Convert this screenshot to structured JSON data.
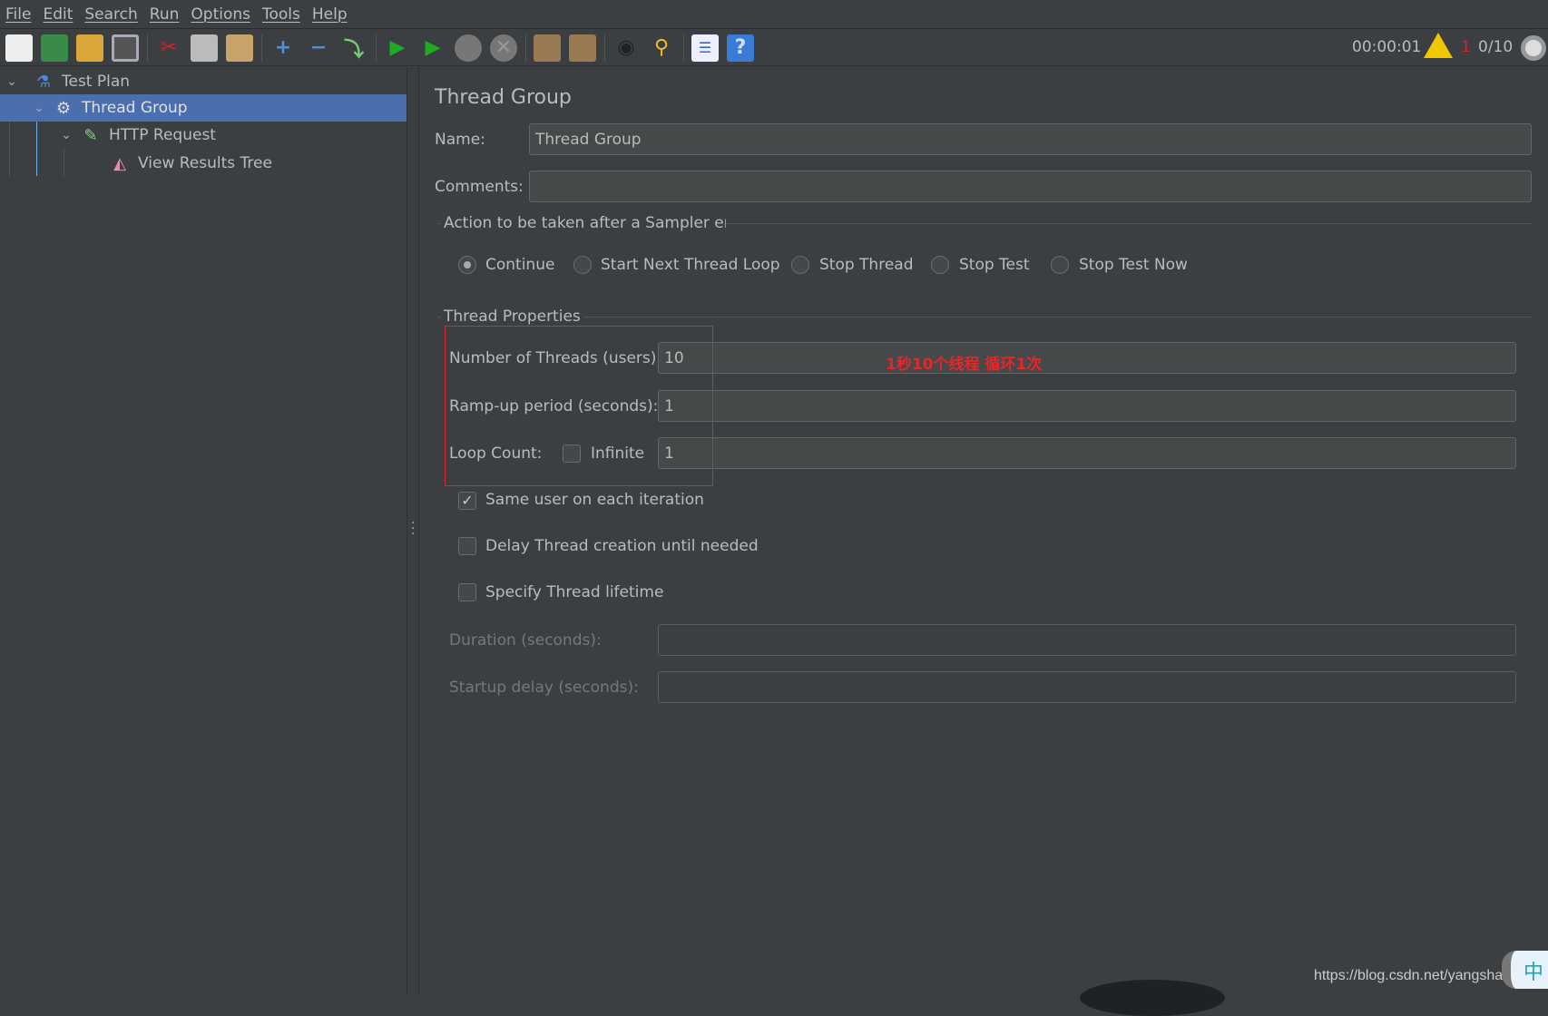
{
  "menu": [
    "File",
    "Edit",
    "Search",
    "Run",
    "Options",
    "Tools",
    "Help"
  ],
  "status": {
    "elapsed": "00:00:01",
    "warnings": "1",
    "threads": "0/10"
  },
  "tree": [
    {
      "label": "Test Plan"
    },
    {
      "label": "Thread Group"
    },
    {
      "label": "HTTP Request"
    },
    {
      "label": "View Results Tree"
    }
  ],
  "panel": {
    "title": "Thread Group",
    "name_label": "Name:",
    "name_value": "Thread Group",
    "comments_label": "Comments:",
    "comments_value": "",
    "error_section": "Action to be taken after a Sampler error",
    "error_options": [
      "Continue",
      "Start Next Thread Loop",
      "Stop Thread",
      "Stop Test",
      "Stop Test Now"
    ],
    "selected_error_option": "Continue",
    "thread_section": "Thread Properties",
    "threads_label": "Number of Threads (users):",
    "threads_value": "10",
    "rampup_label": "Ramp-up period (seconds):",
    "rampup_value": "1",
    "loop_label": "Loop Count:",
    "infinite_label": "Infinite",
    "loop_value": "1",
    "same_user_label": "Same user on each iteration",
    "delay_label": "Delay Thread creation until needed",
    "lifetime_label": "Specify Thread lifetime",
    "duration_label": "Duration (seconds):",
    "duration_value": "",
    "startup_label": "Startup delay (seconds):",
    "startup_value": ""
  },
  "annotation": "1秒10个线程 循环1次",
  "watermark": "https://blog.csdn.net/yangshangwei",
  "ime": "中"
}
